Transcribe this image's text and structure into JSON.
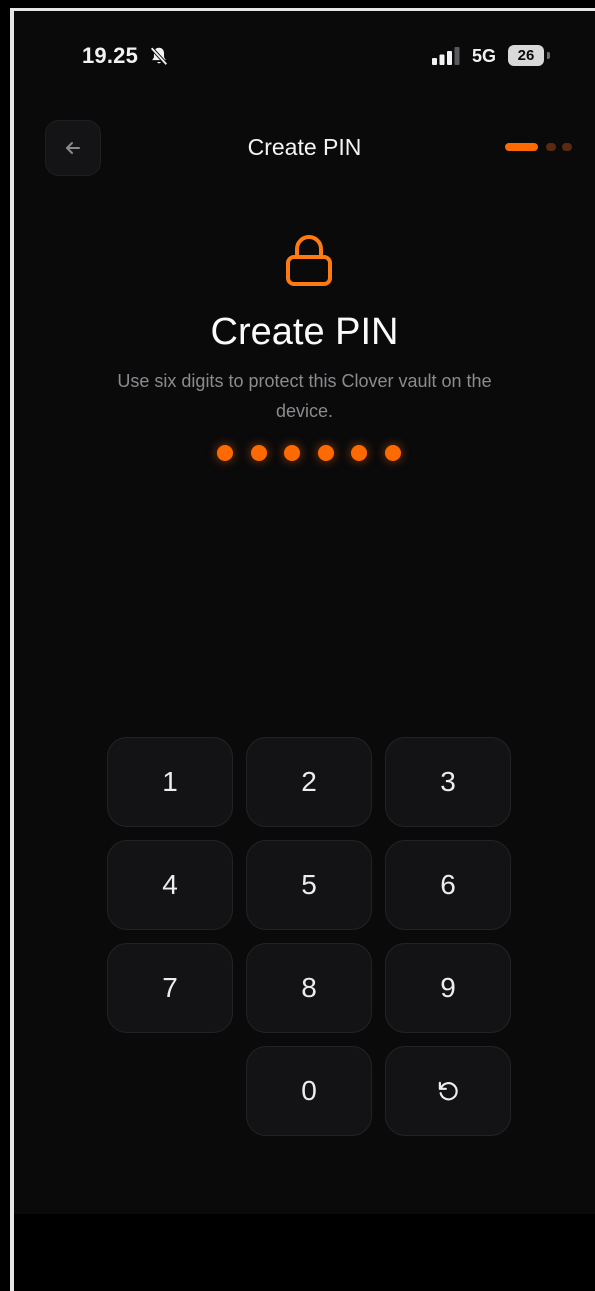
{
  "status_bar": {
    "time": "19.25",
    "network": "5G",
    "battery": "26"
  },
  "header": {
    "title": "Create PIN",
    "steps_total": 3,
    "steps_current": 1
  },
  "main": {
    "title": "Create PIN",
    "subtitle": "Use six digits to protect this Clover vault on the device.",
    "pin_length": 6,
    "pin_entered": 6
  },
  "keypad": {
    "k1": "1",
    "k2": "2",
    "k3": "3",
    "k4": "4",
    "k5": "5",
    "k6": "6",
    "k7": "7",
    "k8": "8",
    "k9": "9",
    "k0": "0"
  },
  "icons": {
    "back": "arrow-left-icon",
    "lock": "lock-icon",
    "reset": "rotate-ccw-icon",
    "bell": "bell-slash-icon"
  },
  "colors": {
    "accent": "#ff6a00",
    "background": "#0a0a0b",
    "key_bg": "#131315"
  }
}
